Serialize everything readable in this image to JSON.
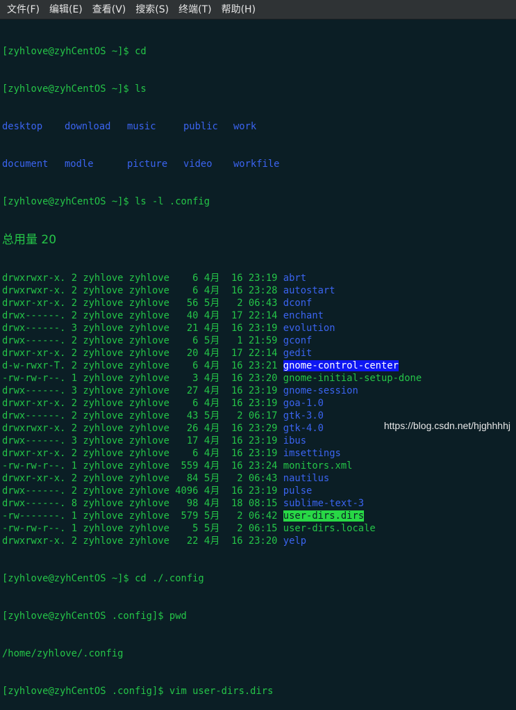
{
  "menubar": {
    "items": [
      "文件(F)",
      "编辑(E)",
      "查看(V)",
      "搜索(S)",
      "终端(T)",
      "帮助(H)"
    ]
  },
  "colors": {
    "background": "#0b1e25",
    "text_green": "#25c548",
    "dir_blue": "#3b64f0",
    "highlight_blue": "#0d16f2",
    "highlight_green": "#28d845"
  },
  "terminal": {
    "prompt_home": "[zyhlove@zyhCentOS ~]$ ",
    "cmd_cd": "cd",
    "cmd_ls": "ls",
    "ls_items": [
      [
        "desktop",
        "download",
        "music",
        "public",
        "work"
      ],
      [
        "document",
        "modle",
        "picture",
        "video",
        "workfile"
      ]
    ],
    "cmd_ls_l": "ls -l .config",
    "total_label": "总用量 20",
    "listing": [
      {
        "perms": "drwxrwxr-x.",
        "links": "2",
        "owner": "zyhlove",
        "group": "zyhlove",
        "size": "6",
        "month": "4月",
        "day": "16",
        "time": "23:19",
        "name": "abrt",
        "style": "dir"
      },
      {
        "perms": "drwxrwxr-x.",
        "links": "2",
        "owner": "zyhlove",
        "group": "zyhlove",
        "size": "6",
        "month": "4月",
        "day": "16",
        "time": "23:28",
        "name": "autostart",
        "style": "dir"
      },
      {
        "perms": "drwxr-xr-x.",
        "links": "2",
        "owner": "zyhlove",
        "group": "zyhlove",
        "size": "56",
        "month": "5月",
        "day": "2",
        "time": "06:43",
        "name": "dconf",
        "style": "dir"
      },
      {
        "perms": "drwx------.",
        "links": "2",
        "owner": "zyhlove",
        "group": "zyhlove",
        "size": "40",
        "month": "4月",
        "day": "17",
        "time": "22:14",
        "name": "enchant",
        "style": "dir"
      },
      {
        "perms": "drwx------.",
        "links": "3",
        "owner": "zyhlove",
        "group": "zyhlove",
        "size": "21",
        "month": "4月",
        "day": "16",
        "time": "23:19",
        "name": "evolution",
        "style": "dir"
      },
      {
        "perms": "drwx------.",
        "links": "2",
        "owner": "zyhlove",
        "group": "zyhlove",
        "size": "6",
        "month": "5月",
        "day": "1",
        "time": "21:59",
        "name": "gconf",
        "style": "dir"
      },
      {
        "perms": "drwxr-xr-x.",
        "links": "2",
        "owner": "zyhlove",
        "group": "zyhlove",
        "size": "20",
        "month": "4月",
        "day": "17",
        "time": "22:14",
        "name": "gedit",
        "style": "dir"
      },
      {
        "perms": "d-w-rwxr-T.",
        "links": "2",
        "owner": "zyhlove",
        "group": "zyhlove",
        "size": "6",
        "month": "4月",
        "day": "16",
        "time": "23:21",
        "name": "gnome-control-center",
        "style": "hl-blue"
      },
      {
        "perms": "-rw-rw-r--.",
        "links": "1",
        "owner": "zyhlove",
        "group": "zyhlove",
        "size": "3",
        "month": "4月",
        "day": "16",
        "time": "23:20",
        "name": "gnome-initial-setup-done",
        "style": "file"
      },
      {
        "perms": "drwx------.",
        "links": "3",
        "owner": "zyhlove",
        "group": "zyhlove",
        "size": "27",
        "month": "4月",
        "day": "16",
        "time": "23:19",
        "name": "gnome-session",
        "style": "dir"
      },
      {
        "perms": "drwxr-xr-x.",
        "links": "2",
        "owner": "zyhlove",
        "group": "zyhlove",
        "size": "6",
        "month": "4月",
        "day": "16",
        "time": "23:19",
        "name": "goa-1.0",
        "style": "dir"
      },
      {
        "perms": "drwx------.",
        "links": "2",
        "owner": "zyhlove",
        "group": "zyhlove",
        "size": "43",
        "month": "5月",
        "day": "2",
        "time": "06:17",
        "name": "gtk-3.0",
        "style": "dir"
      },
      {
        "perms": "drwxrwxr-x.",
        "links": "2",
        "owner": "zyhlove",
        "group": "zyhlove",
        "size": "26",
        "month": "4月",
        "day": "16",
        "time": "23:29",
        "name": "gtk-4.0",
        "style": "dir"
      },
      {
        "perms": "drwx------.",
        "links": "3",
        "owner": "zyhlove",
        "group": "zyhlove",
        "size": "17",
        "month": "4月",
        "day": "16",
        "time": "23:19",
        "name": "ibus",
        "style": "dir"
      },
      {
        "perms": "drwxr-xr-x.",
        "links": "2",
        "owner": "zyhlove",
        "group": "zyhlove",
        "size": "6",
        "month": "4月",
        "day": "16",
        "time": "23:19",
        "name": "imsettings",
        "style": "dir"
      },
      {
        "perms": "-rw-rw-r--.",
        "links": "1",
        "owner": "zyhlove",
        "group": "zyhlove",
        "size": "559",
        "month": "4月",
        "day": "16",
        "time": "23:24",
        "name": "monitors.xml",
        "style": "file"
      },
      {
        "perms": "drwxr-xr-x.",
        "links": "2",
        "owner": "zyhlove",
        "group": "zyhlove",
        "size": "84",
        "month": "5月",
        "day": "2",
        "time": "06:43",
        "name": "nautilus",
        "style": "dir"
      },
      {
        "perms": "drwx------.",
        "links": "2",
        "owner": "zyhlove",
        "group": "zyhlove",
        "size": "4096",
        "month": "4月",
        "day": "16",
        "time": "23:19",
        "name": "pulse",
        "style": "dir"
      },
      {
        "perms": "drwx------.",
        "links": "8",
        "owner": "zyhlove",
        "group": "zyhlove",
        "size": "98",
        "month": "4月",
        "day": "18",
        "time": "08:15",
        "name": "sublime-text-3",
        "style": "dir"
      },
      {
        "perms": "-rw-------.",
        "links": "1",
        "owner": "zyhlove",
        "group": "zyhlove",
        "size": "579",
        "month": "5月",
        "day": "2",
        "time": "06:42",
        "name": "user-dirs.dirs",
        "style": "hl-green"
      },
      {
        "perms": "-rw-rw-r--.",
        "links": "1",
        "owner": "zyhlove",
        "group": "zyhlove",
        "size": "5",
        "month": "5月",
        "day": "2",
        "time": "06:15",
        "name": "user-dirs.locale",
        "style": "file"
      },
      {
        "perms": "drwxrwxr-x.",
        "links": "2",
        "owner": "zyhlove",
        "group": "zyhlove",
        "size": "22",
        "month": "4月",
        "day": "16",
        "time": "23:20",
        "name": "yelp",
        "style": "dir"
      }
    ],
    "cmd_cd_config": "cd ./.config",
    "prompt_config": "[zyhlove@zyhCentOS .config]$ ",
    "cmd_pwd": "pwd",
    "pwd_output": "/home/zyhlove/.config",
    "cmd_vim": "vim user-dirs.dirs"
  },
  "watermark": "https://blog.csdn.net/hjghhhhj"
}
